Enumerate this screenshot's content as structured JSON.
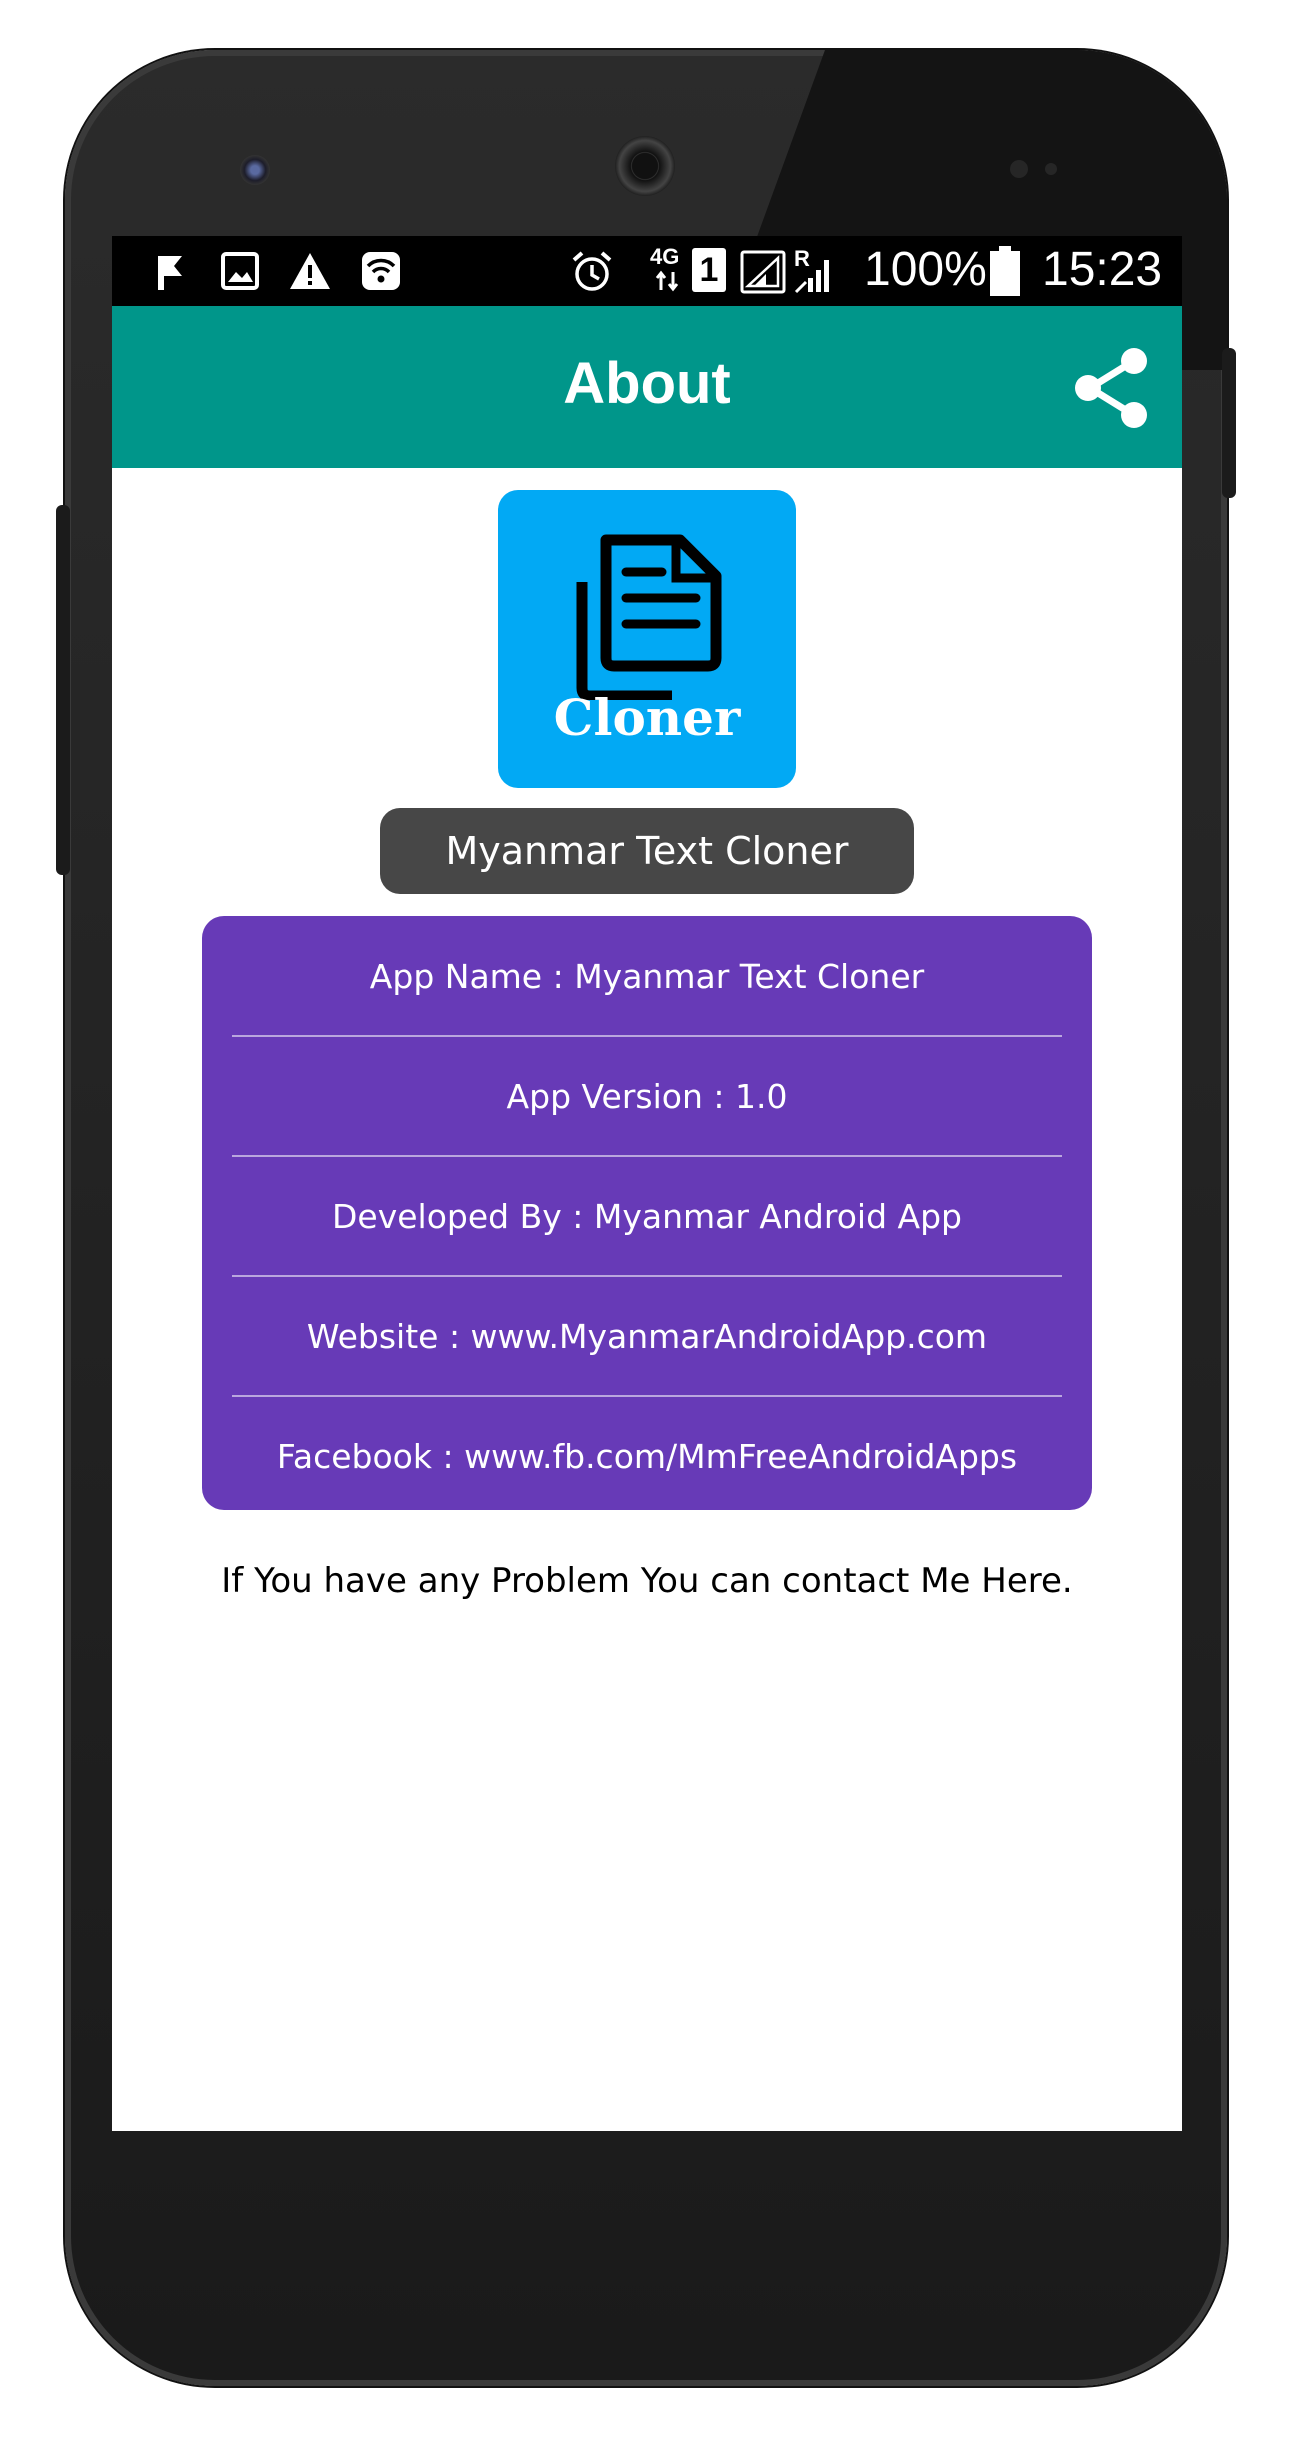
{
  "status_bar": {
    "network_label": "4G",
    "sim_slot": "1",
    "roaming_label": "R",
    "battery": "100%",
    "time": "15:23"
  },
  "appbar": {
    "title": "About",
    "share_icon": "share-icon"
  },
  "logo": {
    "text": "Cloner",
    "background": "#02a9f4",
    "icon": "document-copy-icon"
  },
  "app_name_label": "Myanmar Text Cloner",
  "info": [
    "App Name : Myanmar Text Cloner",
    "App Version : 1.0",
    "Developed By : Myanmar Android App",
    "Website : www.MyanmarAndroidApp.com",
    "Facebook : www.fb.com/MmFreeAndroidApps"
  ],
  "contact_text": "If You have any Problem You can contact Me Here.",
  "colors": {
    "appbar": "#00968a",
    "card": "#673ab7",
    "pill": "#474747"
  }
}
